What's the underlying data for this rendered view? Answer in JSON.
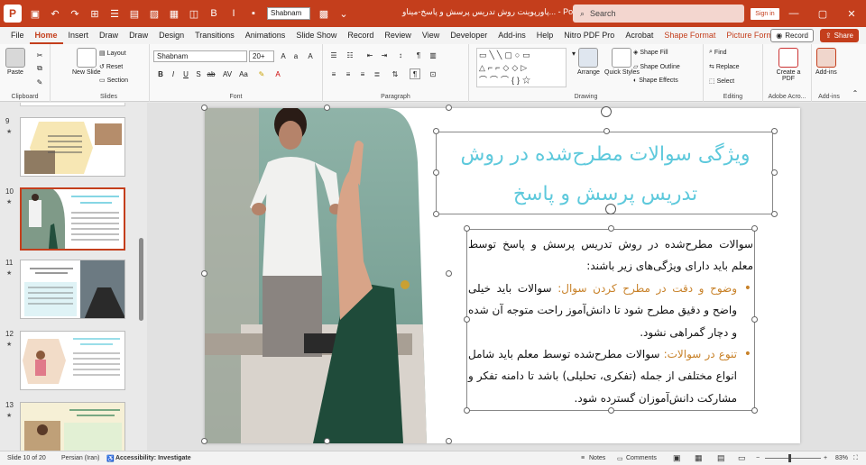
{
  "app": {
    "title": "پاورپوینت روش تدریس پرسش و پاسخ-میناو... - Powe...",
    "search_placeholder": "Search",
    "signin_label": "Sign in",
    "qat_font": "Shabnam",
    "accent": "#c43e1c"
  },
  "tabs": [
    "File",
    "Home",
    "Insert",
    "Draw",
    "Draw",
    "Design",
    "Transitions",
    "Animations",
    "Slide Show",
    "Record",
    "Review",
    "View",
    "Developer",
    "Add-ins",
    "Help",
    "Nitro PDF Pro",
    "Acrobat",
    "Shape Format",
    "Picture Format"
  ],
  "active_tab": "Home",
  "record_label": "Record",
  "share_label": "Share",
  "ribbon": {
    "clipboard": {
      "label": "Clipboard",
      "paste": "Paste"
    },
    "slides": {
      "label": "Slides",
      "new_slide": "New Slide",
      "layout": "Layout",
      "reset": "Reset",
      "section": "Section"
    },
    "font": {
      "label": "Font",
      "font_name": "Shabnam",
      "font_size": "20+"
    },
    "paragraph": {
      "label": "Paragraph"
    },
    "drawing": {
      "label": "Drawing",
      "arrange": "Arrange",
      "quick_styles": "Quick Styles",
      "shape_fill": "Shape Fill",
      "shape_outline": "Shape Outline",
      "shape_effects": "Shape Effects"
    },
    "editing": {
      "label": "Editing",
      "find": "Find",
      "replace": "Replace",
      "select": "Select"
    },
    "adobe": {
      "label": "Adobe Acro...",
      "create_pdf": "Create a PDF"
    },
    "addins": {
      "label": "Add-ins",
      "addins_btn": "Add-ins"
    }
  },
  "thumbnails": [
    {
      "num": "9",
      "title": "",
      "selected": false
    },
    {
      "num": "10",
      "title": "ویژگی سوالات مطرح‌شده در روش تدریس پرسش و پاسخ",
      "selected": true
    },
    {
      "num": "11",
      "title": "ویژگی سوالات مطرح‌شده در روش تدریس پرسش و پاسخ",
      "selected": false
    },
    {
      "num": "12",
      "title": "ویژگی سوالات مطرح‌شده در روش تدریس پرسش و پاسخ",
      "selected": false
    },
    {
      "num": "13",
      "title": "روش تدریس پرسش و پاسخ در کلاس حضوری",
      "selected": false
    }
  ],
  "slide": {
    "title": "ویژگی سوالات مطرح‌شده در روش تدریس پرسش و پاسخ",
    "intro": "سوالات مطرح‌شده در روش تدریس پرسش و پاسخ توسط معلم باید دارای ویژگی‌های زیر باشند:",
    "bullets": [
      {
        "heading": "وضوح و دقت در مطرح کردن سوال:",
        "text": " سوالات باید خیلی واضح و دقیق مطرح شود تا دانش‌آموز راحت متوجه آن شده و دچار گمراهی نشود."
      },
      {
        "heading": "تنوع در سوالات:",
        "text": " سوالات مطرح‌شده توسط معلم باید شامل انواع مختلفی از جمله (تفکری، تحلیلی) باشد تا دامنه تفکر و مشارکت دانش‌آموزان گسترده شود."
      }
    ],
    "title_color": "#5ec9dc",
    "highlight_color": "#c8822a"
  },
  "status": {
    "slide_info": "Slide 10 of 20",
    "language": "Persian (Iran)",
    "accessibility": "Accessibility: Investigate",
    "notes": "Notes",
    "comments": "Comments",
    "zoom": "83%"
  }
}
